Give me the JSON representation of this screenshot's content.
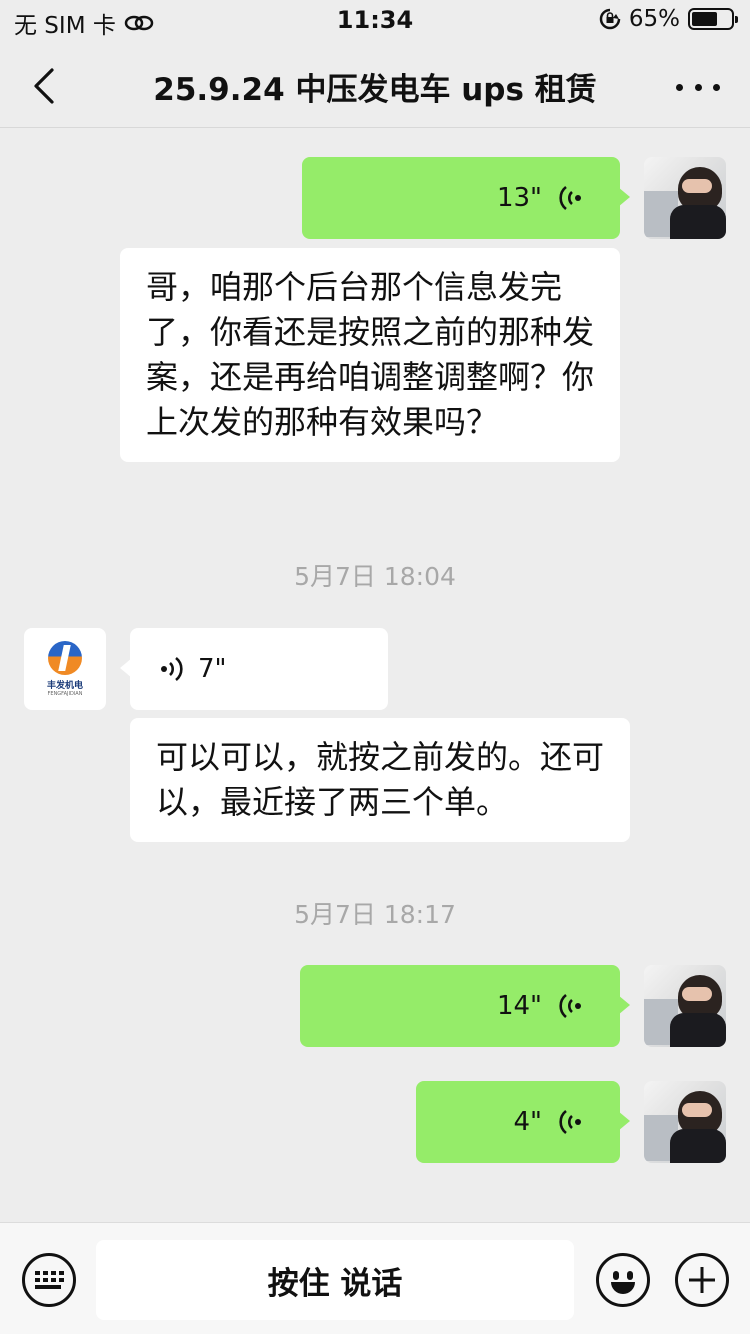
{
  "status_bar": {
    "carrier": "无 SIM 卡",
    "time": "11:34",
    "battery_percent": "65%",
    "battery_level": 0.65,
    "icons": [
      "link-icon",
      "rotation-lock-icon",
      "battery-icon"
    ]
  },
  "nav": {
    "title": "25.9.24 中压发电车 ups 租赁",
    "back_icon": "chevron-left-icon",
    "more_icon": "more-dots-icon"
  },
  "messages": [
    {
      "type": "voice",
      "from": "self",
      "duration": "13\""
    },
    {
      "type": "text",
      "from": "other",
      "text": "哥，咱那个后台那个信息发完了，你看还是按照之前的那种发案，还是再给咱调整调整啊？你上次发的那种有效果吗？"
    },
    {
      "type": "timestamp",
      "text": "5月7日 18:04"
    },
    {
      "type": "voice",
      "from": "other",
      "duration": "7\""
    },
    {
      "type": "text",
      "from": "other",
      "text": "可以可以，就按之前发的。还可以，最近接了两三个单。"
    },
    {
      "type": "timestamp",
      "text": "5月7日 18:17"
    },
    {
      "type": "voice",
      "from": "self",
      "duration": "14\""
    },
    {
      "type": "voice",
      "from": "self",
      "duration": "4\""
    }
  ],
  "other_avatar": {
    "logo_text": "丰发机电",
    "logo_sub": "FENGFAJIDIAN"
  },
  "input_bar": {
    "talk_label": "按住 说话",
    "left_icon": "keyboard-icon",
    "emoji_icon": "emoji-icon",
    "plus_icon": "plus-icon"
  },
  "colors": {
    "self_bubble": "#95ec69",
    "other_bubble": "#ffffff",
    "background": "#ededed"
  }
}
